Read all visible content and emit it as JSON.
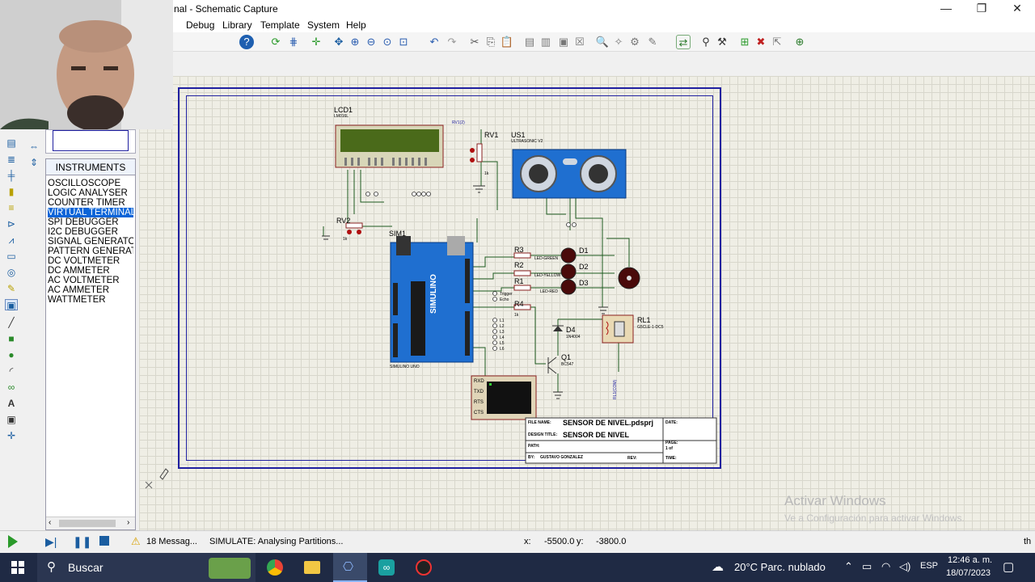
{
  "window": {
    "title": "nal - Schematic Capture",
    "controls": {
      "minimize": "—",
      "maximize": "❐",
      "close": "✕"
    }
  },
  "menu": [
    "Debug",
    "Library",
    "Template",
    "System",
    "Help"
  ],
  "instruments": {
    "header": "INSTRUMENTS",
    "items": [
      "OSCILLOSCOPE",
      "LOGIC ANALYSER",
      "COUNTER TIMER",
      "VIRTUAL TERMINAL",
      "SPI DEBUGGER",
      "I2C DEBUGGER",
      "SIGNAL GENERATOR",
      "PATTERN GENERATO",
      "DC VOLTMETER",
      "DC AMMETER",
      "AC VOLTMETER",
      "AC AMMETER",
      "WATTMETER"
    ],
    "selected": "VIRTUAL TERMINAL"
  },
  "schematic": {
    "lcd": {
      "ref": "LCD1",
      "part": "LM016L"
    },
    "rv1": {
      "ref": "RV1",
      "value": "1k",
      "net": "RV1(2)"
    },
    "rv2": {
      "ref": "RV2",
      "value": "1k"
    },
    "us1": {
      "ref": "US1",
      "part": "ULTRASONIC V2"
    },
    "sim1": {
      "ref": "SIM1",
      "part": "SIMULINO UNO",
      "brand": "SIMULINO"
    },
    "resistors": [
      {
        "ref": "R3",
        "net": "LED-GREEN"
      },
      {
        "ref": "R2",
        "net": "LED-YELLOW"
      },
      {
        "ref": "R1",
        "net": "LED-RED"
      },
      {
        "ref": "R4",
        "value": "1k"
      }
    ],
    "diodes": [
      "D1",
      "D2",
      "D3"
    ],
    "d4": {
      "ref": "D4",
      "part": "1N4004"
    },
    "q1": {
      "ref": "Q1",
      "part": "BC547"
    },
    "rl1": {
      "ref": "RL1",
      "part": "G5CLE-1-DC5"
    },
    "rl_net": "RL1(COM)",
    "pins": {
      "trigger": "Trigger",
      "echo": "Echo",
      "lcd_lines": [
        "L1",
        "L2",
        "L3",
        "L4",
        "L5",
        "L6"
      ]
    },
    "terminal_pins": [
      "RXD",
      "TXD",
      "RTS",
      "CTS"
    ],
    "title_block": {
      "file_label": "FILE NAME:",
      "file_value": "SENSOR DE NIVEL.pdsprj",
      "design_label": "DESIGN TITLE:",
      "design_value": "SENSOR DE NIVEL",
      "path_label": "PATH:",
      "by_label": "BY:",
      "by_value": "GUSTAVO GONZALEZ",
      "rev_label": "REV:",
      "date_label": "DATE:",
      "page_label": "PAGE:",
      "page_value": "1    of",
      "time_label": "TIME:"
    }
  },
  "status": {
    "messages": "18 Messag...",
    "simulate": "SIMULATE: Analysing Partitions...",
    "x_label": "x:",
    "x_value": "-5500.0",
    "y_label": "y:",
    "y_value": "-3800.0",
    "unit": "th"
  },
  "watermark": {
    "line1": "Activar Windows",
    "line2": "Ve a Configuración para activar Windows."
  },
  "taskbar": {
    "search": "Buscar",
    "weather": "20°C  Parc. nublado",
    "lang": "ESP",
    "time": "12:46 a. m.",
    "date": "18/07/2023"
  },
  "colors": {
    "sheet_border": "#2020a0",
    "arduino": "#1f6fd0",
    "wire": "#1e5a1e",
    "grid_bg": "#efeee5",
    "taskbar": "#1f2a44",
    "selection": "#0a64d8"
  }
}
